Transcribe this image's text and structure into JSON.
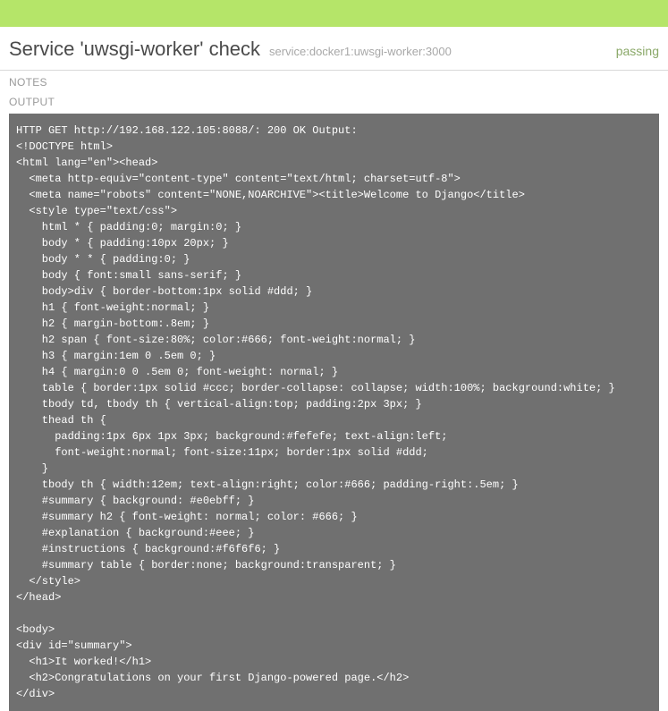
{
  "header": {
    "title": "Service 'uwsgi-worker' check",
    "subtitle": "service:docker1:uwsgi-worker:3000",
    "status": "passing"
  },
  "sections": {
    "notes_label": "NOTES",
    "output_label": "OUTPUT"
  },
  "output": {
    "text": "HTTP GET http://192.168.122.105:8088/: 200 OK Output:\n<!DOCTYPE html>\n<html lang=\"en\"><head>\n  <meta http-equiv=\"content-type\" content=\"text/html; charset=utf-8\">\n  <meta name=\"robots\" content=\"NONE,NOARCHIVE\"><title>Welcome to Django</title>\n  <style type=\"text/css\">\n    html * { padding:0; margin:0; }\n    body * { padding:10px 20px; }\n    body * * { padding:0; }\n    body { font:small sans-serif; }\n    body>div { border-bottom:1px solid #ddd; }\n    h1 { font-weight:normal; }\n    h2 { margin-bottom:.8em; }\n    h2 span { font-size:80%; color:#666; font-weight:normal; }\n    h3 { margin:1em 0 .5em 0; }\n    h4 { margin:0 0 .5em 0; font-weight: normal; }\n    table { border:1px solid #ccc; border-collapse: collapse; width:100%; background:white; }\n    tbody td, tbody th { vertical-align:top; padding:2px 3px; }\n    thead th {\n      padding:1px 6px 1px 3px; background:#fefefe; text-align:left;\n      font-weight:normal; font-size:11px; border:1px solid #ddd;\n    }\n    tbody th { width:12em; text-align:right; color:#666; padding-right:.5em; }\n    #summary { background: #e0ebff; }\n    #summary h2 { font-weight: normal; color: #666; }\n    #explanation { background:#eee; }\n    #instructions { background:#f6f6f6; }\n    #summary table { border:none; background:transparent; }\n  </style>\n</head>\n\n<body>\n<div id=\"summary\">\n  <h1>It worked!</h1>\n  <h2>Congratulations on your first Django-powered page.</h2>\n</div>"
  }
}
